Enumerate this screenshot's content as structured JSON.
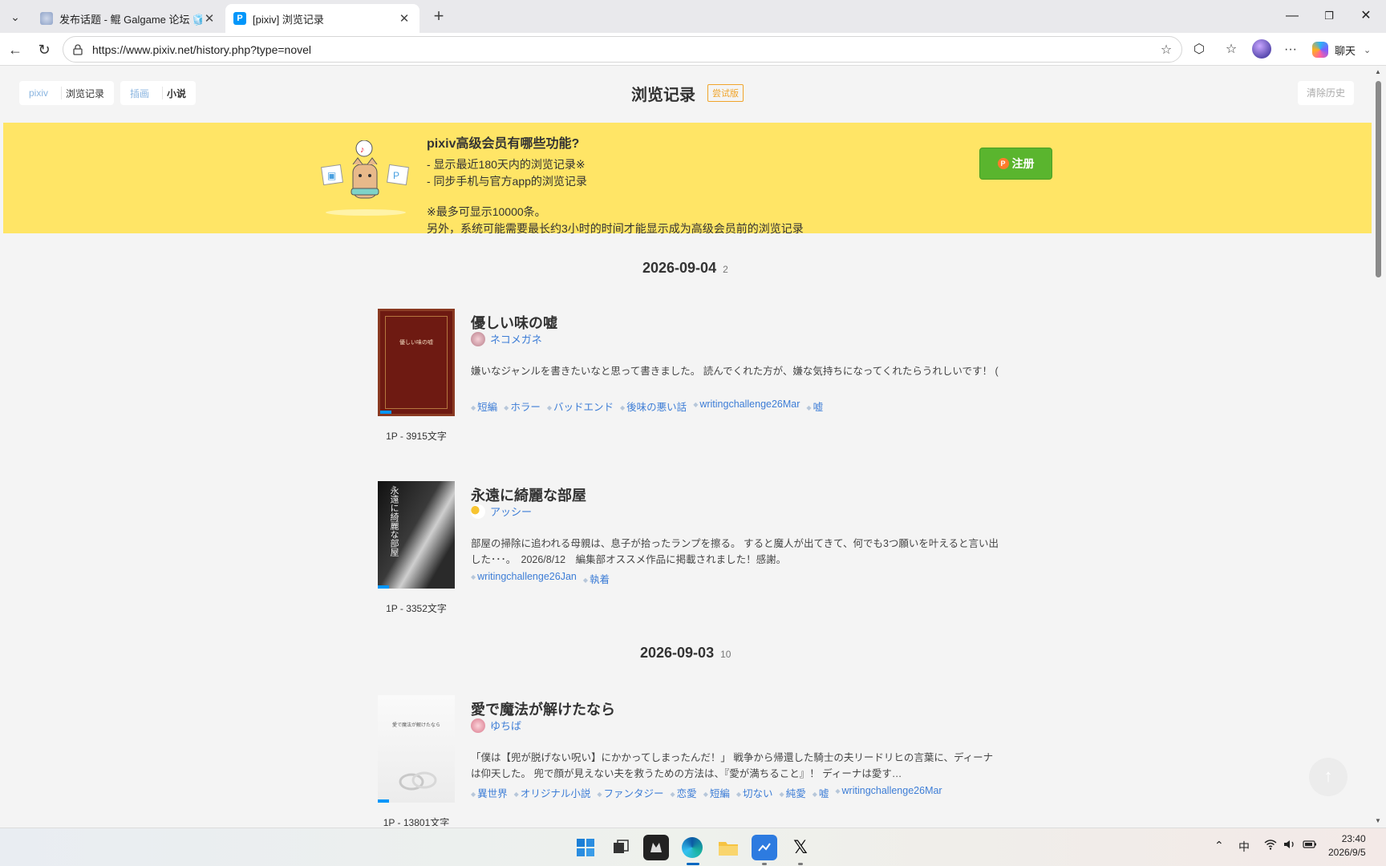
{
  "browser": {
    "tabs": [
      {
        "title": "发布话题 - 鲲 Galgame 论坛 🧊 开",
        "active": false
      },
      {
        "title": "[pixiv] 浏览记录",
        "active": true
      }
    ],
    "url": "https://www.pixiv.net/history.php?type=novel",
    "chat_label": "聊天"
  },
  "breadcrumb": {
    "root": "pixiv",
    "current": "浏览记录",
    "tab_illust": "插画",
    "tab_novel": "小说"
  },
  "header": {
    "title": "浏览记录",
    "badge": "尝试版",
    "clear_label": "清除历史"
  },
  "premium": {
    "heading": "pixiv高级会员有哪些功能?",
    "features": [
      "-  显示最近180天内的浏览记录※",
      "-  同步手机与官方app的浏览记录"
    ],
    "note1": "※最多可显示10000条。",
    "note2": "另外，系统可能需要最长约3小时的时间才能显示成为高级会员前的浏览记录",
    "signup_label": "注册"
  },
  "groups": [
    {
      "date": "2026-09-04",
      "count": "2"
    },
    {
      "date": "2026-09-03",
      "count": "10"
    }
  ],
  "novels": [
    {
      "title": "優しい味の嘘",
      "cover_text": "優しい味の嘘",
      "author": "ネコメガネ",
      "desc": "嫌いなジャンルを書きたいなと思って書きました。 読んでくれた方が、嫌な気持ちになってくれたらうれしいです！ (",
      "tags": [
        "短編",
        "ホラー",
        "バッドエンド",
        "後味の悪い話",
        "writingchallenge26Mar",
        "嘘"
      ],
      "meta": "1P - 3915文字",
      "cover_color": "#6e1a12"
    },
    {
      "title": "永遠に綺麗な部屋",
      "cover_text": "永遠に綺麗な部屋",
      "author": "アッシー",
      "desc": "部屋の掃除に追われる母親は、息子が拾ったランプを擦る。 すると魔人が出てきて、何でも3つ願いを叶えると言い出した･･･。　2026/8/12　編集部オススメ作品に掲載されました！感謝。",
      "tags": [
        "writingchallenge26Jan",
        "執着"
      ],
      "meta": "1P - 3352文字",
      "cover_color": "#1c1c1c"
    },
    {
      "title": "愛で魔法が解けたなら",
      "cover_text": "愛で魔法が解けたなら",
      "author": "ゆちば",
      "desc": "「僕は【兜が脱げない呪い】にかかってしまったんだ！」 戦争から帰還した騎士の夫リードリヒの言葉に、ディーナは仰天した。 兜で顔が見えない夫を救うための方法は、『愛が満ちること』！ ディーナは愛す…",
      "tags": [
        "異世界",
        "オリジナル小説",
        "ファンタジー",
        "恋愛",
        "短編",
        "切ない",
        "純愛",
        "嘘",
        "writingchallenge26Mar"
      ],
      "meta": "1P - 13801文字",
      "cover_color": "#f2f2f2"
    }
  ],
  "taskbar": {
    "ime": "中",
    "time": "23:40",
    "date": "2026/9/5"
  }
}
